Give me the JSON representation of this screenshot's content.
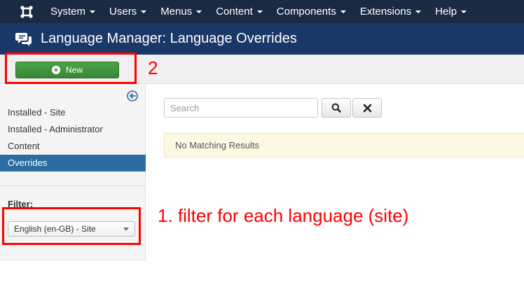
{
  "navbar": {
    "logo_icon": "joomla-logo-icon",
    "items": [
      {
        "label": "System"
      },
      {
        "label": "Users"
      },
      {
        "label": "Menus"
      },
      {
        "label": "Content"
      },
      {
        "label": "Components"
      },
      {
        "label": "Extensions"
      },
      {
        "label": "Help"
      }
    ]
  },
  "header": {
    "icon": "comments-icon",
    "title": "Language Manager: Language Overrides"
  },
  "toolbar": {
    "new_label": "New",
    "new_icon": "plus-circle-icon"
  },
  "sidebar": {
    "collapse_icon": "arrow-left-circle-icon",
    "items": [
      {
        "label": "Installed - Site",
        "active": false
      },
      {
        "label": "Installed - Administrator",
        "active": false
      },
      {
        "label": "Content",
        "active": false
      },
      {
        "label": "Overrides",
        "active": true
      }
    ],
    "filter_label": "Filter:",
    "filter_selected": "English (en-GB) - Site"
  },
  "main": {
    "search_placeholder": "Search",
    "search_icon": "search-icon",
    "clear_icon": "close-icon",
    "alert_text": "No Matching Results"
  },
  "annotations": {
    "new_note": "2",
    "filter_note": "1. filter for each language (site)"
  },
  "colors": {
    "navbar_bg": "#1b2a43",
    "header_bg": "#1a3867",
    "new_button": "#3d8e3a",
    "active_item": "#2d6ca2",
    "alert_bg": "#fcf8e3",
    "annotation": "#ff0000"
  }
}
